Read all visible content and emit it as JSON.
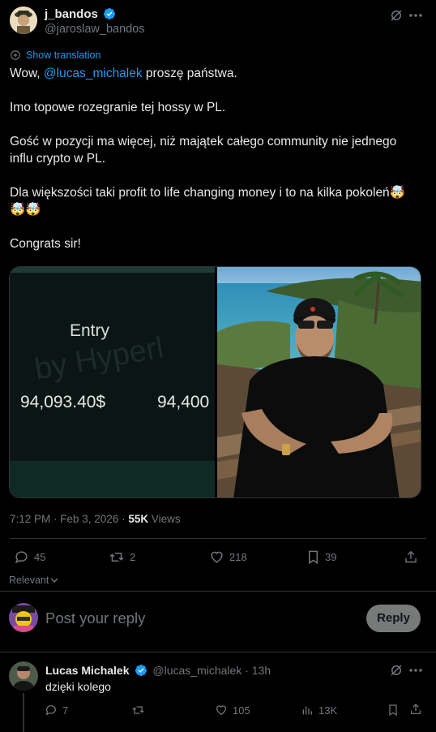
{
  "author": {
    "display_name": "j_bandos",
    "handle": "@jaroslaw_bandos"
  },
  "translate_label": "Show translation",
  "tweet": {
    "line1_pre": "Wow, ",
    "line1_mention": "@lucas_michalek",
    "line1_post": " proszę państwa.",
    "para2": "Imo topowe rozegranie tej hossy w PL.",
    "para3_l1": "Gość w pozycji ma więcej, niż majątek całego community nie jednego",
    "para3_l2": "influ crypto w PL.",
    "para4_l1": "Dla większości taki profit to life changing money i to na kilka pokoleń🤯",
    "para4_l2": "🤯🤯",
    "para5": "Congrats sir!"
  },
  "media": {
    "left_label": "Entry",
    "left_watermark": "by Hyperl",
    "left_value1": "94,093.40$",
    "left_value2": "94,400"
  },
  "meta": {
    "time": "7:12 PM · Feb 3, 2026 · ",
    "views_count": "55K",
    "views_label": " Views"
  },
  "actions": {
    "replies": "45",
    "reposts": "2",
    "likes": "218",
    "bookmarks": "39"
  },
  "sort": {
    "label": "Relevant"
  },
  "composer": {
    "placeholder": "Post your reply",
    "button": "Reply"
  },
  "reply": {
    "display_name": "Lucas Michalek",
    "handle": "@lucas_michalek · 13h",
    "text": "dzięki kolego",
    "replies": "7",
    "likes": "105",
    "views": "13K"
  },
  "colors": {
    "accent": "#1d9bf0",
    "muted": "#71767b",
    "divider": "#2f3336"
  },
  "icons": [
    "verified-badge-icon",
    "grok-icon",
    "more-icon",
    "translate-icon",
    "reply-icon",
    "repost-icon",
    "like-icon",
    "bookmark-icon",
    "share-icon",
    "views-icon",
    "chevron-down-icon"
  ]
}
